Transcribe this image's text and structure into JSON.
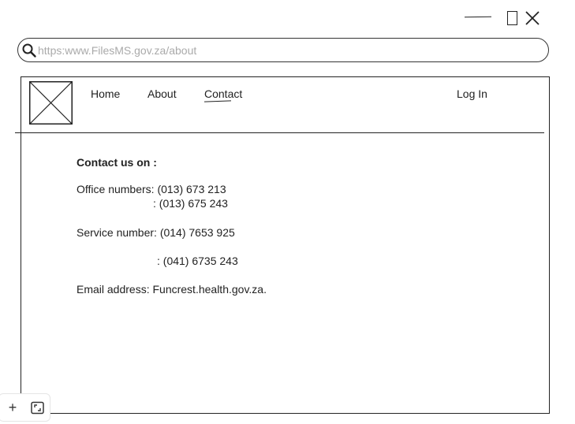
{
  "window_controls": {
    "minimize_icon": "minimize-icon",
    "maximize_icon": "maximize-icon",
    "close_icon": "close-icon"
  },
  "address_bar": {
    "icon": "search-icon",
    "url": "https:www.FilesMS.gov.za/about"
  },
  "header": {
    "logo": "image-placeholder-icon",
    "nav": {
      "home": "Home",
      "about": "About",
      "contact": "Contact",
      "login": "Log In"
    },
    "active_item": "Contact"
  },
  "content": {
    "heading": "Contact us on :",
    "office_line1": "Office numbers: (013) 673 213",
    "office_line2": ": (013) 675 243",
    "service_line1": "Service number: (014) 7653 925",
    "service_line2": ": (041) 6735 243",
    "email_line": "Email address: Funcrest.health.gov.za."
  },
  "toolbar": {
    "add_icon": "plus-icon",
    "add_glyph": "+",
    "frame_icon": "frame-icon"
  }
}
